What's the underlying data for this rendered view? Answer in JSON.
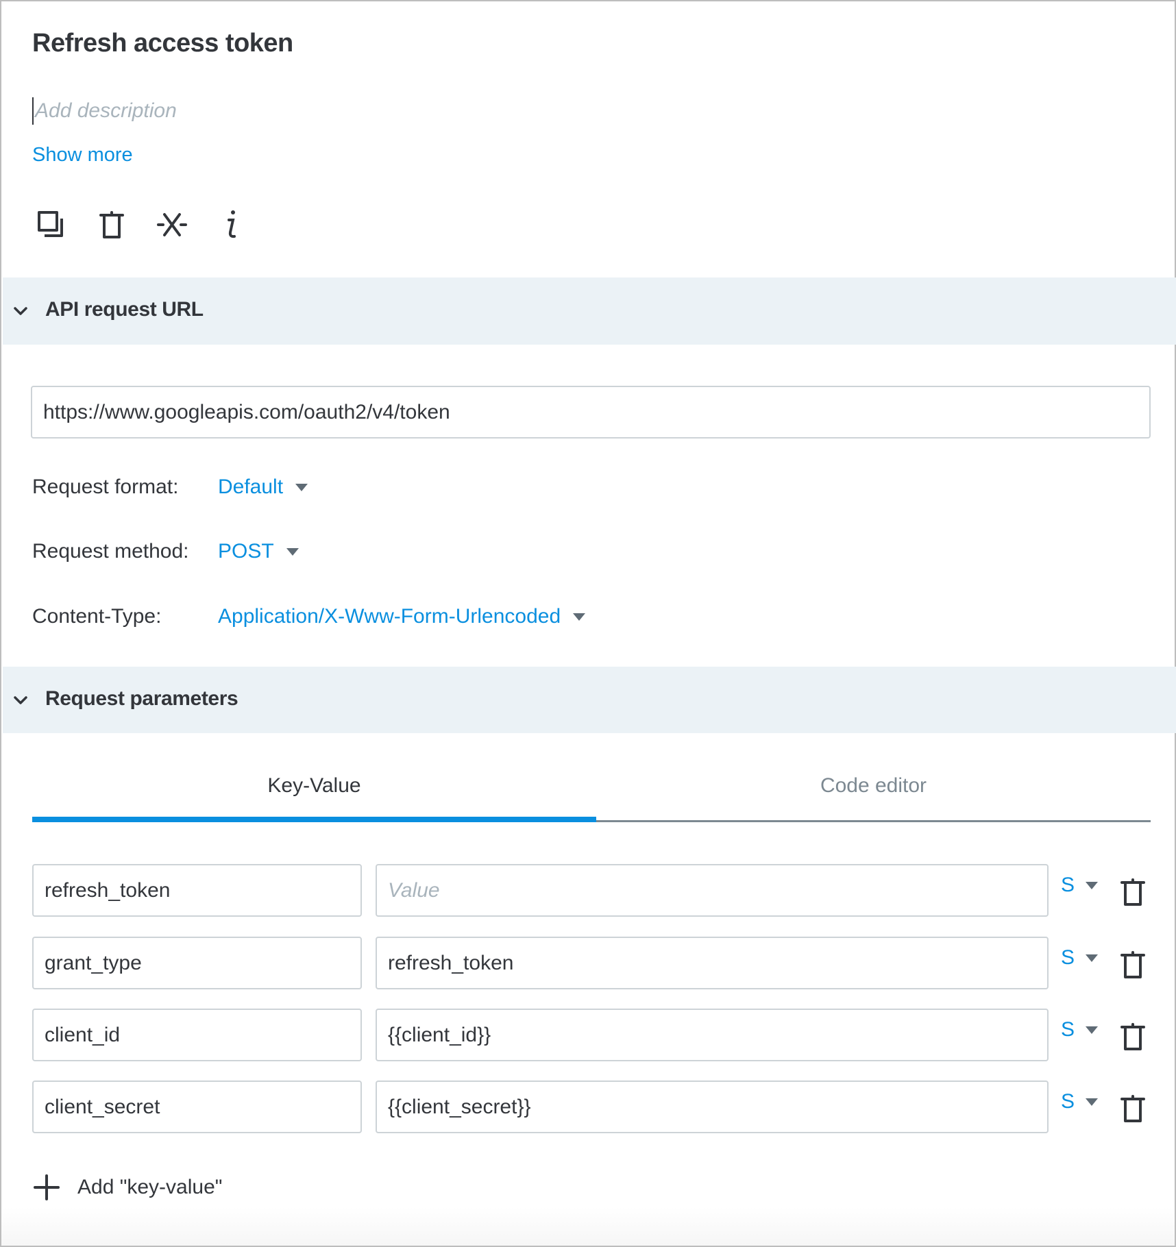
{
  "header": {
    "title": "Refresh access token",
    "description_placeholder": "Add description",
    "show_more": "Show more",
    "toolbar_icons": [
      "duplicate-icon",
      "trash-icon",
      "disconnect-icon",
      "info-icon"
    ]
  },
  "api_section": {
    "title": "API request URL",
    "url": "https://www.googleapis.com/oauth2/v4/token",
    "fields": [
      {
        "label": "Request format:",
        "value": "Default"
      },
      {
        "label": "Request method:",
        "value": "POST"
      },
      {
        "label": "Content-Type:",
        "value": "Application/X-Www-Form-Urlencoded"
      }
    ]
  },
  "params_section": {
    "title": "Request parameters",
    "tabs": [
      {
        "label": "Key-Value",
        "active": true
      },
      {
        "label": "Code editor",
        "active": false
      }
    ],
    "value_placeholder": "Value",
    "rows": [
      {
        "key": "refresh_token",
        "value": "",
        "type": "S"
      },
      {
        "key": "grant_type",
        "value": "refresh_token",
        "type": "S"
      },
      {
        "key": "client_id",
        "value": "{{client_id}}",
        "type": "S"
      },
      {
        "key": "client_secret",
        "value": "{{client_secret}}",
        "type": "S"
      }
    ],
    "add_label": "Add \"key-value\""
  },
  "colors": {
    "accent": "#0a8fdf",
    "text": "#33363b",
    "band": "#ebf2f6",
    "placeholder": "#a9b4bc"
  }
}
